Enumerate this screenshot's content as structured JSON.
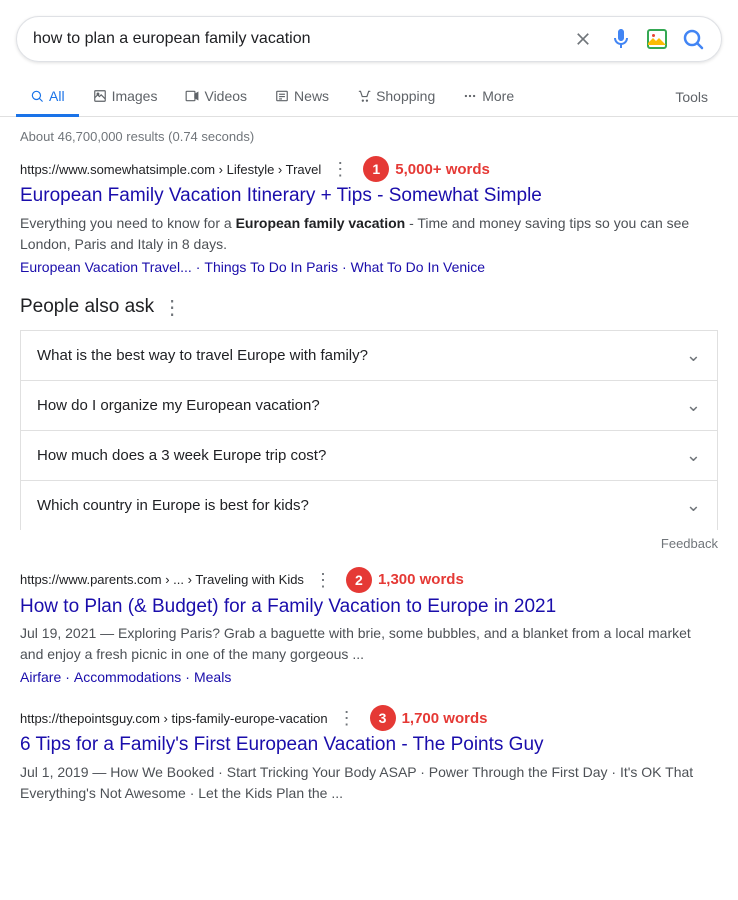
{
  "search": {
    "query": "how to plan a european family vacation",
    "placeholder": "Search"
  },
  "nav": {
    "tabs": [
      {
        "id": "all",
        "label": "All",
        "active": true,
        "icon": "search"
      },
      {
        "id": "images",
        "label": "Images",
        "icon": "images"
      },
      {
        "id": "videos",
        "label": "Videos",
        "icon": "videos"
      },
      {
        "id": "news",
        "label": "News",
        "icon": "news"
      },
      {
        "id": "shopping",
        "label": "Shopping",
        "icon": "shopping"
      },
      {
        "id": "more",
        "label": "More",
        "icon": "more"
      }
    ],
    "tools_label": "Tools"
  },
  "results": {
    "count_text": "About 46,700,000 results (0.74 seconds)",
    "items": [
      {
        "id": 1,
        "url": "https://www.somewhatsimple.com › Lifestyle › Travel",
        "badge_number": "1",
        "badge_words": "5,000+ words",
        "title": "European Family Vacation Itinerary + Tips - Somewhat Simple",
        "snippet_parts": [
          {
            "text": "Everything you need to know for a "
          },
          {
            "text": "European family vacation",
            "bold": true
          },
          {
            "text": " - Time and money saving tips so you can see London, Paris and Italy in 8 days."
          }
        ],
        "links": [
          "European Vacation Travel...",
          "Things To Do In Paris",
          "What To Do In Venice"
        ]
      },
      {
        "id": 2,
        "url": "https://www.parents.com › ... › Traveling with Kids",
        "badge_number": "2",
        "badge_words": "1,300 words",
        "title": "How to Plan (& Budget) for a Family Vacation to Europe in 2021",
        "snippet": "Jul 19, 2021 — Exploring Paris? Grab a baguette with brie, some bubbles, and a blanket from a local market and enjoy a fresh picnic in one of the many gorgeous ...",
        "links": [
          "Airfare",
          "Accommodations",
          "Meals"
        ],
        "links_sep": "·"
      },
      {
        "id": 3,
        "url": "https://thepointsguy.com › tips-family-europe-vacation",
        "badge_number": "3",
        "badge_words": "1,700 words",
        "title": "6 Tips for a Family's First European Vacation - The Points Guy",
        "snippet": "Jul 1, 2019 — How We Booked · Start Tricking Your Body ASAP · Power Through the First Day · It's OK That Everything's Not Awesome · Let the Kids Plan the ..."
      }
    ],
    "paa": {
      "title": "People also ask",
      "questions": [
        "What is the best way to travel Europe with family?",
        "How do I organize my European vacation?",
        "How much does a 3 week Europe trip cost?",
        "Which country in Europe is best for kids?"
      ]
    },
    "feedback_label": "Feedback"
  }
}
